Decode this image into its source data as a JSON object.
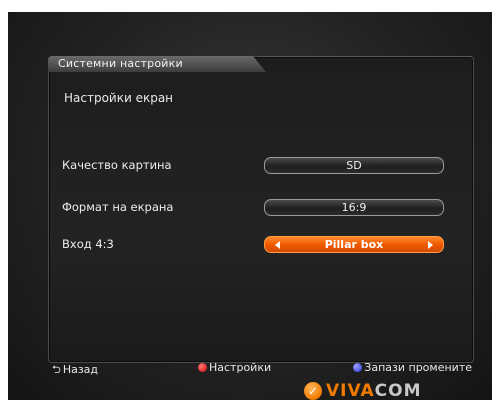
{
  "panel": {
    "title": "Системни настройки",
    "subtitle": "Настройки екран"
  },
  "settings": [
    {
      "label": "Качество картина",
      "value": "SD",
      "active": false
    },
    {
      "label": "Формат на екрана",
      "value": "16:9",
      "active": false
    },
    {
      "label": "Вход 4:3",
      "value": "Pillar box",
      "active": true
    }
  ],
  "footer": {
    "back_label": "Назад",
    "settings_label": "Настройки",
    "save_label": "Запази промените"
  },
  "brand": {
    "name_main": "VIVA",
    "name_end": "COM"
  },
  "colors": {
    "accent": "#f05a00",
    "red_button": "#d40000",
    "blue_button": "#2a34d8"
  }
}
